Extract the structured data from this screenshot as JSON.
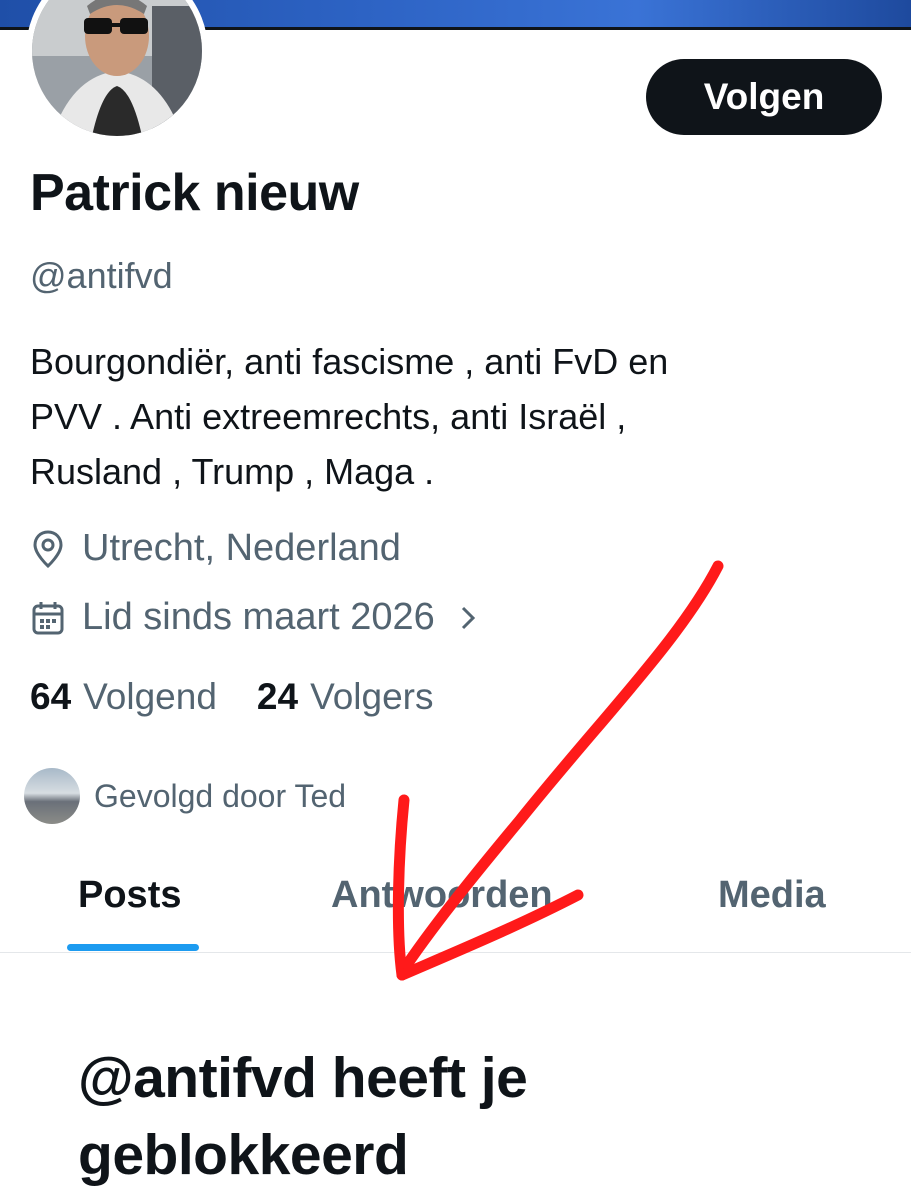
{
  "profile": {
    "follow_label": "Volgen",
    "name": "Patrick nieuw",
    "handle": "@antifvd",
    "bio_lines": [
      "Bourgondiër, anti fascisme , anti FvD en",
      "PVV . Anti extreemrechts, anti Israël ,",
      "Rusland , Trump , Maga ."
    ],
    "location": "Utrecht, Nederland",
    "joined": "Lid sinds maart 2026",
    "following_count": "64",
    "following_label": "Volgend",
    "followers_count": "24",
    "followers_label": "Volgers",
    "followed_by": "Gevolgd door Ted"
  },
  "tabs": [
    {
      "label": "Posts",
      "active": true
    },
    {
      "label": "Antwoorden",
      "active": false
    },
    {
      "label": "Media",
      "active": false
    }
  ],
  "blocked_message": "@antifvd heeft je geblokkeerd",
  "colors": {
    "text_primary": "#0f1419",
    "text_secondary": "#536471",
    "accent": "#1d9bf0",
    "annotation": "#ff0000"
  },
  "icons": {
    "location": "map-pin-icon",
    "joined": "calendar-icon",
    "chevron": "chevron-right-icon"
  }
}
